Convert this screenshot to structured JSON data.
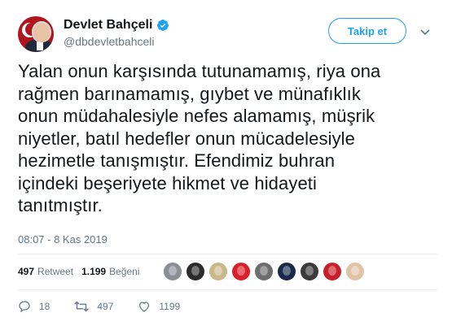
{
  "tweet": {
    "author": {
      "display_name": "Devlet Bahçeli",
      "handle": "@dbdevletbahceli",
      "verified": true
    },
    "follow_label": "Takip et",
    "text": "Yalan onun karşısında tutunamamış, riya ona\nrağmen barınamamış, gıybet ve münafıklık\nonun müdahalesiyle nefes alamamış, müşrik\nniyetler, batıl hedefler onun mücadelesiyle\nhezimetle tanışmıştır. Efendimiz buhran\niçindeki beşeriyete hikmet ve hidayeti\ntanıtmıştır.",
    "timestamp": "08:07 - 8 Kas 2019",
    "stats": {
      "retweet_count": "497",
      "retweet_label": "Retweet",
      "like_count": "1.199",
      "like_label": "Beğeni"
    },
    "likers": [
      "#8a8f96",
      "#2b2b2b",
      "#c9b98a",
      "#d9202a",
      "#6d6d6d",
      "#1a2a4a",
      "#3b3b3b",
      "#c8202a",
      "#e0c4a8"
    ],
    "actions": {
      "reply_count": "18",
      "retweet_count": "497",
      "like_count": "1199"
    },
    "colors": {
      "accent": "#1da1f2",
      "muted": "#657786",
      "text": "#14171a"
    }
  }
}
